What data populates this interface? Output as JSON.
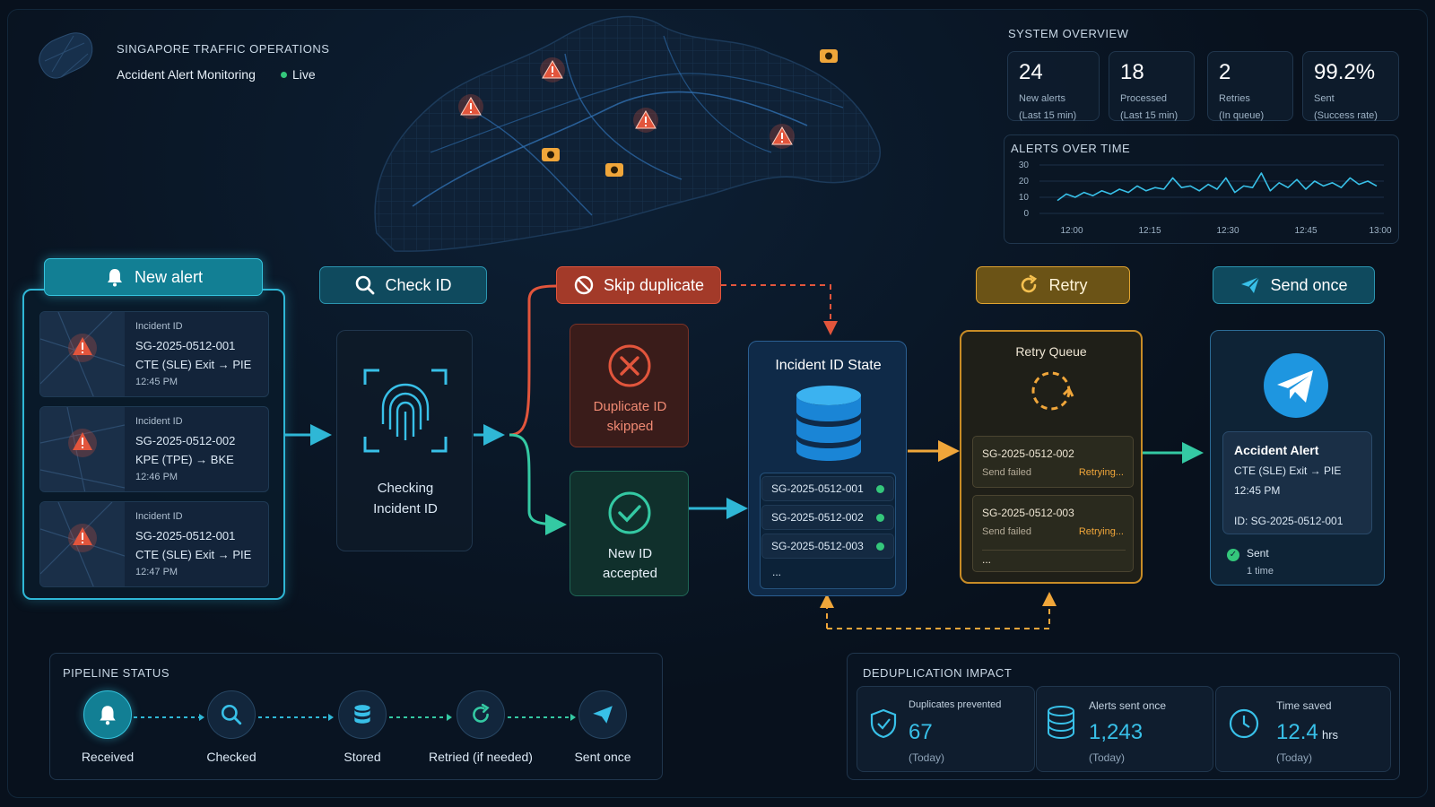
{
  "header": {
    "title": "SINGAPORE TRAFFIC OPERATIONS",
    "subtitle": "Accident Alert Monitoring",
    "live_label": "Live"
  },
  "colors": {
    "background": "#08111d",
    "teal": "#1d9fb8",
    "red": "#e2553c",
    "orange": "#f0a63a",
    "green": "#34c77b",
    "blue": "#38c0e8"
  },
  "map": {
    "alert_icons": [
      "warning-icon",
      "warning-icon",
      "warning-icon",
      "warning-icon"
    ],
    "camera_icons": [
      "camera-icon",
      "camera-icon",
      "camera-icon"
    ]
  },
  "system_overview": {
    "title": "SYSTEM OVERVIEW",
    "stats": [
      {
        "value": "24",
        "label": "New alerts",
        "sub": "(Last 15 min)"
      },
      {
        "value": "18",
        "label": "Processed",
        "sub": "(Last 15 min)"
      },
      {
        "value": "2",
        "label": "Retries",
        "sub": "(In queue)"
      },
      {
        "value": "99.2%",
        "label": "Sent",
        "sub": "(Success rate)"
      }
    ]
  },
  "alerts_over_time": {
    "title": "ALERTS OVER TIME"
  },
  "chart_data": {
    "type": "line",
    "title": "ALERTS OVER TIME",
    "x_ticks": [
      "12:00",
      "12:15",
      "12:30",
      "12:45",
      "13:00"
    ],
    "y_ticks": [
      "30",
      "20",
      "10",
      "0"
    ],
    "ylim": [
      0,
      30
    ],
    "grid": true,
    "series": [
      {
        "values": [
          8,
          12,
          10,
          13,
          11,
          14,
          12,
          15,
          13,
          17,
          14,
          16,
          15,
          22,
          16,
          17,
          14,
          18,
          15,
          22,
          13,
          17,
          16,
          25,
          14,
          19,
          16,
          21,
          15,
          20,
          17,
          19,
          16,
          22,
          18,
          20,
          17
        ]
      }
    ]
  },
  "flow": {
    "new_alert": "New alert",
    "check_id": "Check ID",
    "skip_duplicate": "Skip duplicate",
    "retry": "Retry",
    "send_once": "Send once"
  },
  "incidents": [
    {
      "key": "Incident ID",
      "id": "SG-2025-0512-001",
      "route": "CTE (SLE) Exit → PIE",
      "time": "12:45 PM"
    },
    {
      "key": "Incident ID",
      "id": "SG-2025-0512-002",
      "route": "KPE (TPE) → BKE",
      "time": "12:46 PM"
    },
    {
      "key": "Incident ID",
      "id": "SG-2025-0512-001",
      "route": "CTE (SLE) Exit → PIE",
      "time": "12:47 PM"
    }
  ],
  "checking": {
    "line1": "Checking",
    "line2": "Incident ID"
  },
  "duplicate": {
    "line1": "Duplicate ID",
    "line2": "skipped"
  },
  "accepted": {
    "line1": "New ID",
    "line2": "accepted"
  },
  "state": {
    "title": "Incident ID State",
    "rows": [
      "SG-2025-0512-001",
      "SG-2025-0512-002",
      "SG-2025-0512-003"
    ],
    "more": "..."
  },
  "retry_queue": {
    "title": "Retry Queue",
    "items": [
      {
        "id": "SG-2025-0512-002",
        "status": "Send failed",
        "state": "Retrying..."
      },
      {
        "id": "SG-2025-0512-003",
        "status": "Send failed",
        "state": "Retrying..."
      }
    ],
    "more": "..."
  },
  "message": {
    "title": "Accident Alert",
    "route": "CTE (SLE) Exit → PIE",
    "time": "12:45 PM",
    "id_line": "ID: SG-2025-0512-001",
    "sent": "Sent",
    "count": "1 time"
  },
  "pipeline": {
    "title": "PIPELINE STATUS",
    "steps": [
      "Received",
      "Checked",
      "Stored",
      "Retried (if needed)",
      "Sent once"
    ]
  },
  "dedup": {
    "title": "DEDUPLICATION IMPACT",
    "items": [
      {
        "label": "Duplicates prevented",
        "value": "67",
        "unit": "",
        "sub": "(Today)"
      },
      {
        "label": "Alerts sent once",
        "value": "1,243",
        "unit": "",
        "sub": "(Today)"
      },
      {
        "label": "Time saved",
        "value": "12.4",
        "unit": "hrs",
        "sub": "(Today)"
      }
    ]
  }
}
